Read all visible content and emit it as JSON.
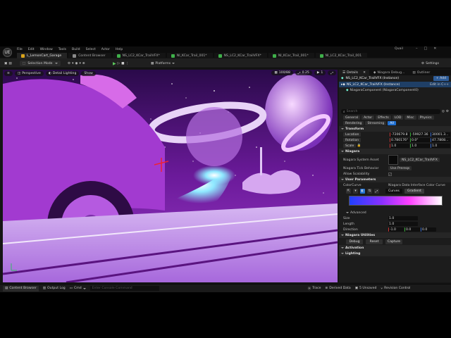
{
  "app": {
    "project": "Quail",
    "logo": "UE"
  },
  "menu": [
    "File",
    "Edit",
    "Window",
    "Tools",
    "Build",
    "Select",
    "Actor",
    "Help"
  ],
  "tabs": [
    {
      "label": "L_LemonCart_Garage",
      "active": true,
      "color": "#d9a31a"
    },
    {
      "label": "Content Browser",
      "active": false,
      "color": "#8a8a8a"
    },
    {
      "label": "NS_LC2_KCar_TrailVFX*",
      "active": false,
      "color": "#3fb04a"
    },
    {
      "label": "NI_KCar_Trail_001*",
      "active": false,
      "color": "#3fb04a"
    },
    {
      "label": "NS_LC2_KCar_TrailVFX*",
      "active": false,
      "color": "#3fb04a"
    },
    {
      "label": "NI_KCar_Trail_001*",
      "active": false,
      "color": "#3fb04a"
    },
    {
      "label": "NI_LC2_KCar_Trail_001",
      "active": false,
      "color": "#3fb04a"
    }
  ],
  "toolbar": {
    "mode": "Selection Mode",
    "platforms": "Platforms",
    "settings": "Settings"
  },
  "viewport": {
    "perspective": "Perspective",
    "lighting": "Detail Lighting",
    "show": "Show",
    "count": "100/88",
    "fov": "0.25",
    "speed": "1"
  },
  "details": {
    "tabs": [
      "Details",
      "Niagara Debug...",
      "Outliner"
    ],
    "actor": "NS_LC2_KCar_TrailVFX (Instance)",
    "add": "+ Add",
    "component": "NiagaraComponent (NiagaraComponent0)",
    "edit_in": "Edit in C++",
    "search_placeholder": "Search",
    "categories_row1": [
      "General",
      "Actor",
      "Effects",
      "LOD",
      "Misc",
      "Physics"
    ],
    "categories_row2": [
      "Rendering",
      "Streaming",
      "All"
    ],
    "transform": {
      "title": "Transform",
      "location": {
        "label": "Location",
        "values": [
          "-720679.8",
          "-59927.36",
          "30001.3..."
        ]
      },
      "rotation": {
        "label": "Rotation",
        "values": [
          "0.780176°",
          "0.0°",
          "47.7808..."
        ]
      },
      "scale": {
        "label": "Scale",
        "values": [
          "1.0",
          "1.0",
          "1.0"
        ]
      }
    },
    "niagara": {
      "title": "Niagara",
      "system_asset_label": "Niagara System Asset",
      "system_asset_value": "NS_LC2_KCar_TrailVFX",
      "tick_label": "Niagara Tick Behavior",
      "tick_value": "Use Prereqs",
      "scalability_label": "Allow Scalability"
    },
    "user_params": {
      "title": "User Parameters",
      "colorcurve_label": "ColorCurve",
      "colorcurve_value": "Niagara Data Interface Color Curve",
      "curves_tab": "Curves",
      "gradient_tab": "Gradient",
      "advanced": "Advanced",
      "size_label": "Size",
      "size_value": "1.0",
      "length_label": "Length",
      "length_value": "1.0",
      "direction_label": "Direction",
      "direction_values": [
        "-1.0",
        "0.0",
        "0.0"
      ]
    },
    "utilities": {
      "title": "Niagara Utilities",
      "buttons": [
        "Debug",
        "Reset",
        "Capture"
      ]
    },
    "activation": "Activation",
    "lighting": "Lighting"
  },
  "bottom": {
    "content_browser": "Content Browser",
    "output_log": "Output Log",
    "cmd": "Cmd",
    "console_placeholder": "Enter Console Command",
    "trace": "Trace",
    "derived": "Derived Data",
    "unsaved": "5 Unsaved",
    "revision": "Revision Control"
  }
}
